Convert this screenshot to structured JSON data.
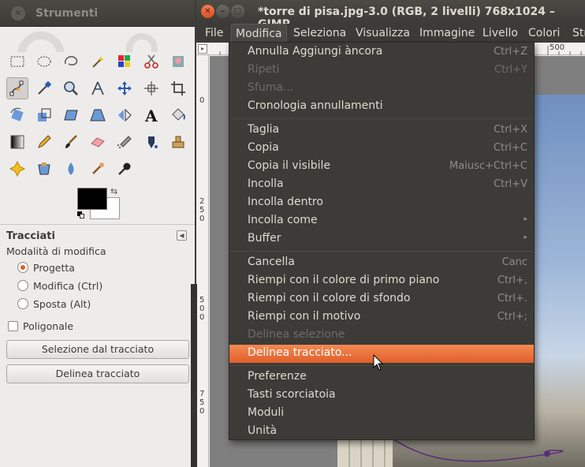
{
  "toolbox": {
    "title": "Strumenti",
    "tools": [
      "rect-select-icon",
      "ellipse-select-icon",
      "free-select-icon",
      "fuzzy-select-icon",
      "color-select-icon",
      "scissors-icon",
      "foreground-select-icon",
      "paths-icon",
      "color-picker-icon",
      "zoom-icon",
      "measure-icon",
      "move-icon",
      "align-icon",
      "crop-icon",
      "rotate-icon",
      "scale-icon",
      "shear-icon",
      "perspective-icon",
      "flip-icon",
      "text-icon",
      "bucket-fill-icon",
      "blend-icon",
      "pencil-icon",
      "paintbrush-icon",
      "eraser-icon",
      "airbrush-icon",
      "ink-icon",
      "clone-icon",
      "heal-icon",
      "perspective-clone-icon",
      "blur-icon",
      "smudge-icon",
      "dodge-icon"
    ],
    "selected_tool": "paths-icon",
    "fg_color": "#000000",
    "bg_color": "#ffffff",
    "options": {
      "title": "Tracciati",
      "mode_label": "Modalità di modifica",
      "modes": [
        "Progetta",
        "Modifica (Ctrl)",
        "Sposta (Alt)"
      ],
      "selected_mode": 0,
      "polygonal_label": "Poligonale",
      "selection_button": "Selezione dal tracciato",
      "stroke_button": "Delinea tracciato"
    }
  },
  "main": {
    "title": "*torre di pisa.jpg-3.0 (RGB, 2 livelli) 768x1024 – GIMP",
    "menubar": [
      "File",
      "Modifica",
      "Seleziona",
      "Visualizza",
      "Immagine",
      "Livello",
      "Colori",
      "Str"
    ],
    "active_menu": "Modifica",
    "ruler_top_label": "500",
    "ruler_left_labels": [
      "0",
      "2\n5\n0",
      "5\n0\n0",
      "7\n5\n0"
    ]
  },
  "edit_menu": {
    "groups": [
      [
        {
          "label": "Annulla Aggiungi àncora",
          "accel": "Ctrl+Z",
          "enabled": true
        },
        {
          "label": "Ripeti",
          "accel": "Ctrl+Y",
          "enabled": false
        },
        {
          "label": "Sfuma...",
          "accel": "",
          "enabled": false
        },
        {
          "label": "Cronologia annullamenti",
          "accel": "",
          "enabled": true
        }
      ],
      [
        {
          "label": "Taglia",
          "accel": "Ctrl+X",
          "enabled": true
        },
        {
          "label": "Copia",
          "accel": "Ctrl+C",
          "enabled": true
        },
        {
          "label": "Copia il visibile",
          "accel": "Maiusc+Ctrl+C",
          "enabled": true
        },
        {
          "label": "Incolla",
          "accel": "Ctrl+V",
          "enabled": true
        },
        {
          "label": "Incolla dentro",
          "accel": "",
          "enabled": true
        },
        {
          "label": "Incolla come",
          "accel": "",
          "enabled": true,
          "submenu": true
        },
        {
          "label": "Buffer",
          "accel": "",
          "enabled": true,
          "submenu": true
        }
      ],
      [
        {
          "label": "Cancella",
          "accel": "Canc",
          "enabled": true
        },
        {
          "label": "Riempi con il colore di primo piano",
          "accel": "Ctrl+,",
          "enabled": true
        },
        {
          "label": "Riempi con il colore di sfondo",
          "accel": "Ctrl+.",
          "enabled": true
        },
        {
          "label": "Riempi con il motivo",
          "accel": "Ctrl+;",
          "enabled": true
        },
        {
          "label": "Delinea selezione",
          "accel": "",
          "enabled": false
        },
        {
          "label": "Delinea tracciato...",
          "accel": "",
          "enabled": true,
          "highlighted": true
        }
      ],
      [
        {
          "label": "Preferenze",
          "accel": "",
          "enabled": true
        },
        {
          "label": "Tasti scorciatoia",
          "accel": "",
          "enabled": true
        },
        {
          "label": "Moduli",
          "accel": "",
          "enabled": true
        },
        {
          "label": "Unità",
          "accel": "",
          "enabled": true
        }
      ]
    ],
    "highlight_color": "#f07746"
  }
}
